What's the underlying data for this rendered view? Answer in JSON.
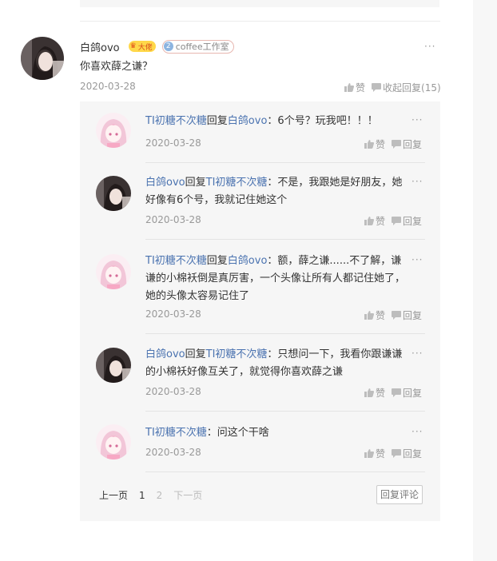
{
  "main": {
    "username": "白鸽ovo",
    "badge_ambassador": "大佬",
    "badge_studio_num": "2",
    "badge_studio": "coffee工作室",
    "text": "你喜欢薛之谦？",
    "date": "2020-03-28",
    "like_label": "赞",
    "collapse_reply_label": "收起回复(15)",
    "more": "···"
  },
  "replies": [
    {
      "user": "TI初糖不次糖",
      "verb": "回复",
      "target": "白鸽ovo",
      "sep": "：",
      "text": "6个号？玩我吧！！！",
      "date": "2020-03-28",
      "like": "赞",
      "reply": "回复",
      "more": "···"
    },
    {
      "user": "白鸽ovo",
      "verb": "回复",
      "target": "TI初糖不次糖",
      "sep": "：",
      "text": "不是，我跟她是好朋友，她好像有6个号，我就记住她这个",
      "date": "2020-03-28",
      "like": "赞",
      "reply": "回复",
      "more": "···"
    },
    {
      "user": "TI初糖不次糖",
      "verb": "回复",
      "target": "白鸽ovo",
      "sep": "：",
      "text": "额，薛之谦......不了解，谦谦的小棉袄倒是真厉害，一个头像让所有人都记住她了，她的头像太容易记住了",
      "date": "2020-03-28",
      "like": "赞",
      "reply": "回复",
      "more": "···"
    },
    {
      "user": "白鸽ovo",
      "verb": "回复",
      "target": "TI初糖不次糖",
      "sep": "：",
      "text": "只想问一下，我看你跟谦谦的小棉袄好像互关了，就觉得你喜欢薛之谦",
      "date": "2020-03-28",
      "like": "赞",
      "reply": "回复",
      "more": "···"
    },
    {
      "user": "TI初糖不次糖",
      "verb": "",
      "target": "",
      "sep": "：",
      "text": "问这个干啥",
      "date": "2020-03-28",
      "like": "赞",
      "reply": "回复",
      "more": "···"
    }
  ],
  "pager": {
    "prev": "上一页",
    "page1": "1",
    "page2": "2",
    "next": "下一页",
    "reply_comment": "回复评论"
  },
  "colors": {
    "link": "#4b73b0",
    "badge": "#ffd84a"
  }
}
